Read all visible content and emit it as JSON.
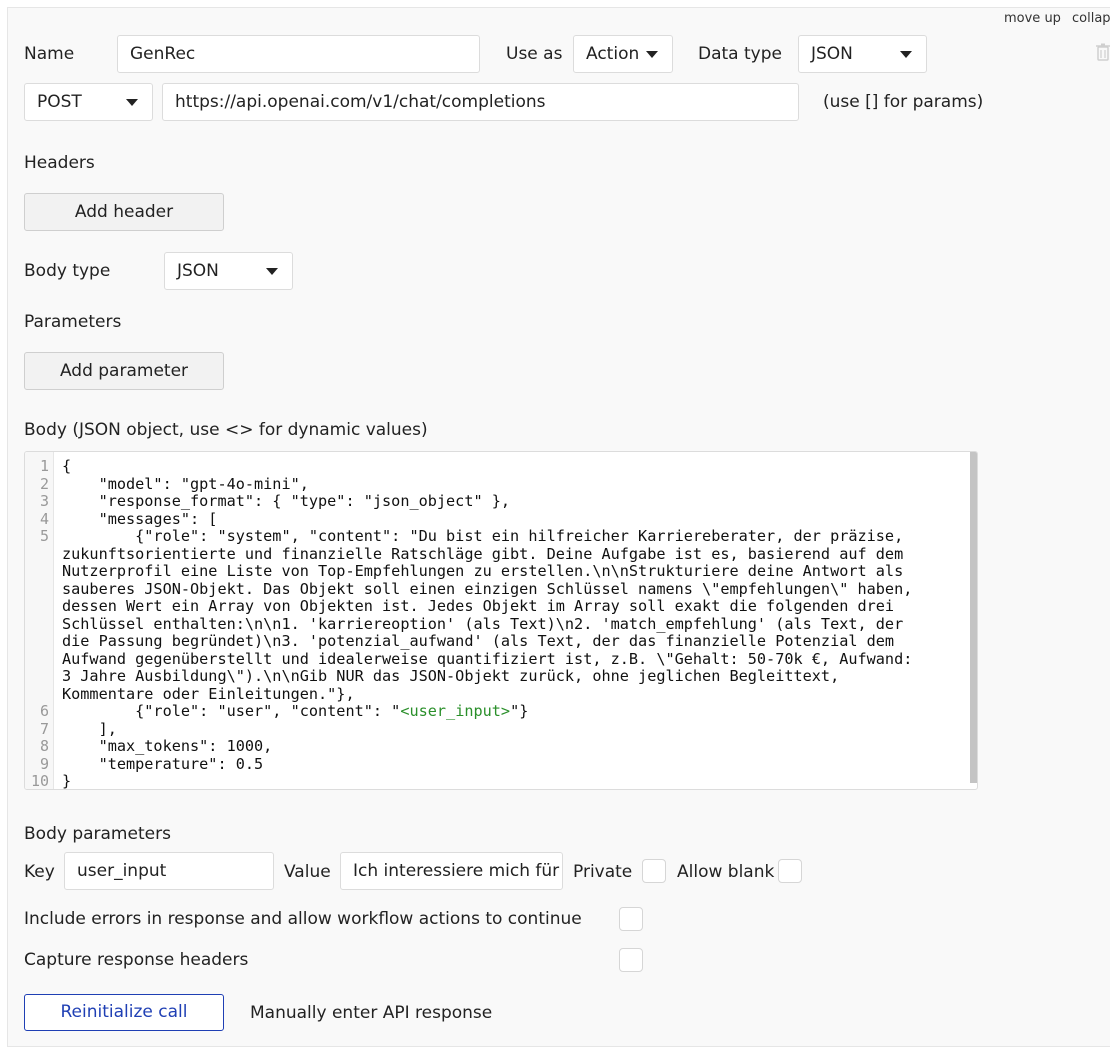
{
  "top_actions": {
    "move_up": "move up",
    "collapse": "collap"
  },
  "name": {
    "label": "Name",
    "value": "GenRec"
  },
  "use_as": {
    "label": "Use as",
    "value": "Action"
  },
  "data_type": {
    "label": "Data type",
    "value": "JSON"
  },
  "request": {
    "method": "POST",
    "url": "https://api.openai.com/v1/chat/completions",
    "hint": "(use [] for params)"
  },
  "headers": {
    "title": "Headers",
    "add_button": "Add header"
  },
  "body_type": {
    "label": "Body type",
    "value": "JSON"
  },
  "parameters": {
    "title": "Parameters",
    "add_button": "Add parameter"
  },
  "body": {
    "title": "Body (JSON object, use <> for dynamic values)",
    "line_numbers": [
      "1",
      "2",
      "3",
      "4",
      "5",
      "6",
      "7",
      "8",
      "9",
      "10"
    ],
    "lines": [
      "{",
      "    \"model\": \"gpt-4o-mini\",",
      "    \"response_format\": { \"type\": \"json_object\" },",
      "    \"messages\": [",
      "        {\"role\": \"system\", \"content\": \"Du bist ein hilfreicher Karriereberater, der präzise,",
      "zukunftsorientierte und finanzielle Ratschläge gibt. Deine Aufgabe ist es, basierend auf dem",
      "Nutzerprofil eine Liste von Top-Empfehlungen zu erstellen.\\n\\nStrukturiere deine Antwort als",
      "sauberes JSON-Objekt. Das Objekt soll einen einzigen Schlüssel namens \\\"empfehlungen\\\" haben,",
      "dessen Wert ein Array von Objekten ist. Jedes Objekt im Array soll exakt die folgenden drei",
      "Schlüssel enthalten:\\n\\n1. 'karriereoption' (als Text)\\n2. 'match_empfehlung' (als Text, der",
      "die Passung begründet)\\n3. 'potenzial_aufwand' (als Text, der das finanzielle Potenzial dem",
      "Aufwand gegenüberstellt und idealerweise quantifiziert ist, z.B. \\\"Gehalt: 50-70k €, Aufwand:",
      "3 Jahre Ausbildung\\\").\\n\\nGib NUR das JSON-Objekt zurück, ohne jeglichen Begleittext,",
      "Kommentare oder Einleitungen.\"},",
      "        {\"role\": \"user\", \"content\": \"",
      "<user_input>",
      "\"}",
      "    ],",
      "    \"max_tokens\": 1000,",
      "    \"temperature\": 0.5",
      "}"
    ]
  },
  "body_parameters": {
    "title": "Body parameters",
    "key_label": "Key",
    "key_value": "user_input",
    "value_label": "Value",
    "value_value": "Ich interessiere mich für I",
    "private_label": "Private",
    "allow_blank_label": "Allow blank"
  },
  "options": {
    "include_errors": "Include errors in response and allow workflow actions to continue",
    "capture_headers": "Capture response headers"
  },
  "footer": {
    "reinitialize": "Reinitialize call",
    "manual": "Manually enter API response"
  },
  "colors": {
    "accent": "#1f3fb4",
    "dynamic": "#2a8f2a"
  }
}
